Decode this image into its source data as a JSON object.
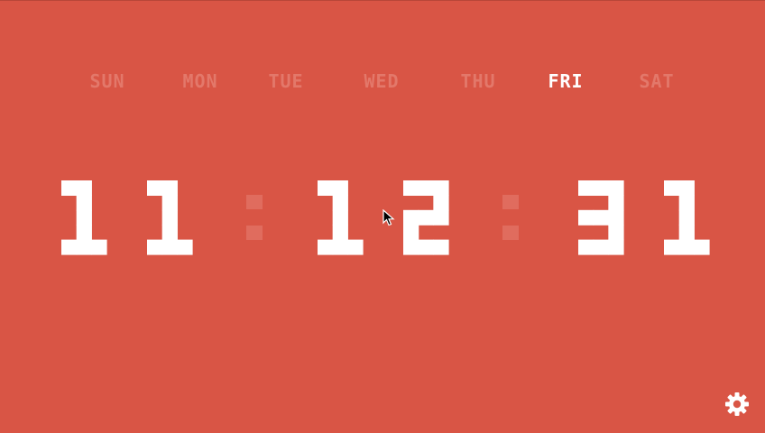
{
  "weekdays": {
    "days": [
      "SUN",
      "MON",
      "TUE",
      "WED",
      "THU",
      "FRI",
      "SAT"
    ],
    "active": "FRI",
    "active_color": "#ffffff",
    "inactive_color": "#e3786a"
  },
  "clock": {
    "time": "11:12:31",
    "hours": "11",
    "minutes": "12",
    "seconds": "31",
    "digit_color": "#ffffff",
    "separator_color": "#e06c5e"
  },
  "theme": {
    "background": "#d95545"
  },
  "settings": {
    "icon": "gear-icon"
  }
}
